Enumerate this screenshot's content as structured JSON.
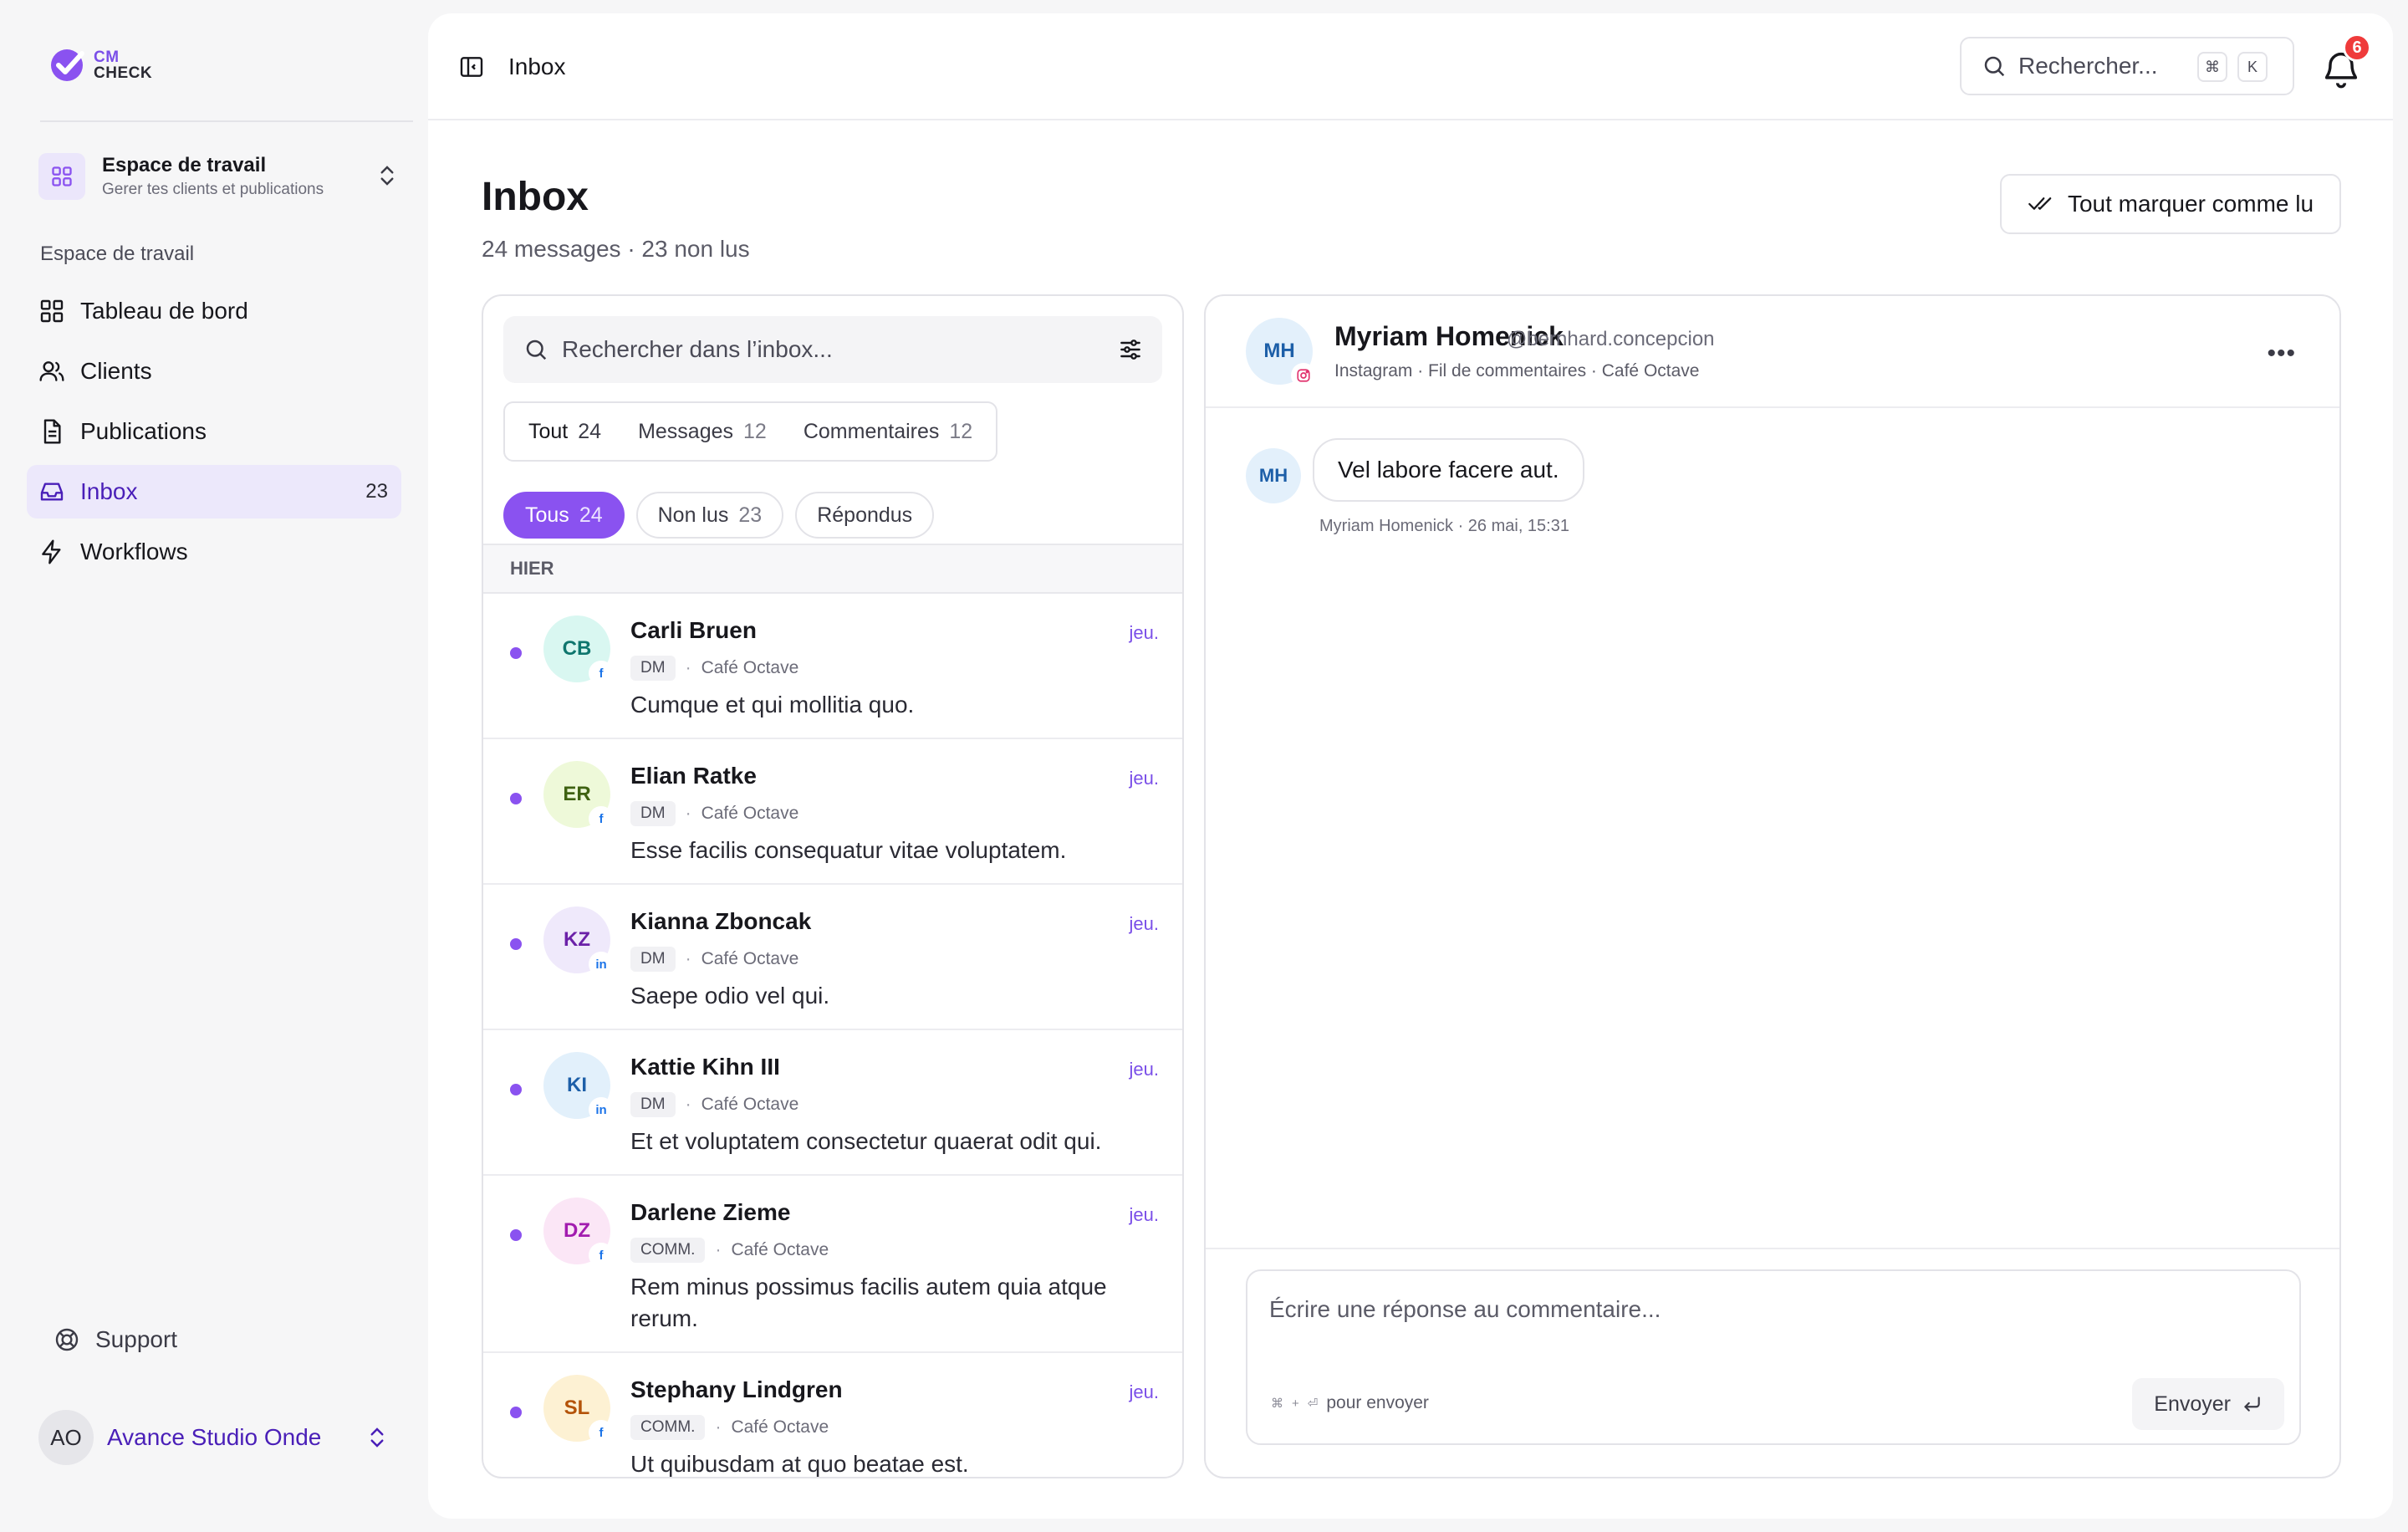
{
  "brand": {
    "logo_line1": "CM",
    "logo_line2": "CHECK",
    "accent": "#8a52f0"
  },
  "workspace": {
    "title": "Espace de travail",
    "subtitle": "Gerer tes clients et publications"
  },
  "sidebar": {
    "section_label": "Espace de travail",
    "items": [
      {
        "label": "Tableau de bord",
        "icon": "grid-icon"
      },
      {
        "label": "Clients",
        "icon": "users-icon"
      },
      {
        "label": "Publications",
        "icon": "file-icon"
      },
      {
        "label": "Inbox",
        "icon": "inbox-icon",
        "count": "23",
        "active": true
      },
      {
        "label": "Workflows",
        "icon": "bolt-icon"
      }
    ],
    "support_label": "Support",
    "account": {
      "initials": "AO",
      "name": "Avance Studio Onde"
    }
  },
  "topbar": {
    "title": "Inbox",
    "search_placeholder": "Rechercher...",
    "kbd1": "⌘",
    "kbd2": "K",
    "notif_count": "6"
  },
  "page": {
    "title": "Inbox",
    "subtitle": "24 messages · 23 non lus",
    "mark_all_label": "Tout marquer comme lu"
  },
  "list": {
    "search_placeholder": "Rechercher dans l’inbox...",
    "tabs": [
      {
        "label": "Tout",
        "count": "24"
      },
      {
        "label": "Messages",
        "count": "12"
      },
      {
        "label": "Commentaires",
        "count": "12"
      }
    ],
    "filters": [
      {
        "label": "Tous",
        "count": "24"
      },
      {
        "label": "Non lus",
        "count": "23"
      },
      {
        "label": "Répondus",
        "count": ""
      }
    ],
    "group_label": "HIER",
    "messages": [
      {
        "initials": "CB",
        "name": "Carli Bruen",
        "time": "jeu.",
        "tag": "DM",
        "client": "Café Octave",
        "text": "Cumque et qui mollitia quo.",
        "network": "facebook"
      },
      {
        "initials": "ER",
        "name": "Elian Ratke",
        "time": "jeu.",
        "tag": "DM",
        "client": "Café Octave",
        "text": "Esse facilis consequatur vitae voluptatem.",
        "network": "facebook"
      },
      {
        "initials": "KZ",
        "name": "Kianna Zboncak",
        "time": "jeu.",
        "tag": "DM",
        "client": "Café Octave",
        "text": "Saepe odio vel qui.",
        "network": "linkedin"
      },
      {
        "initials": "KI",
        "name": "Kattie Kihn III",
        "time": "jeu.",
        "tag": "DM",
        "client": "Café Octave",
        "text": "Et et voluptatem consectetur quaerat odit qui.",
        "network": "linkedin"
      },
      {
        "initials": "DZ",
        "name": "Darlene Zieme",
        "time": "jeu.",
        "tag": "COMM.",
        "client": "Café Octave",
        "text": "Rem minus possimus facilis autem quia atque rerum.",
        "network": "facebook"
      },
      {
        "initials": "SL",
        "name": "Stephany Lindgren",
        "time": "jeu.",
        "tag": "COMM.",
        "client": "Café Octave",
        "text": "Ut quibusdam at quo beatae est.",
        "network": "facebook"
      }
    ]
  },
  "conversation": {
    "initials": "MH",
    "name": "Myriam Homenick",
    "handle": "@bernhard.concepcion",
    "context": "Instagram · Fil de commentaires · Café Octave",
    "message_text": "Vel labore facere aut.",
    "message_meta": "Myriam Homenick · 26 mai, 15:31",
    "reply_placeholder": "Écrire une réponse au commentaire...",
    "reply_hint": "pour envoyer",
    "send_label": "Envoyer"
  }
}
